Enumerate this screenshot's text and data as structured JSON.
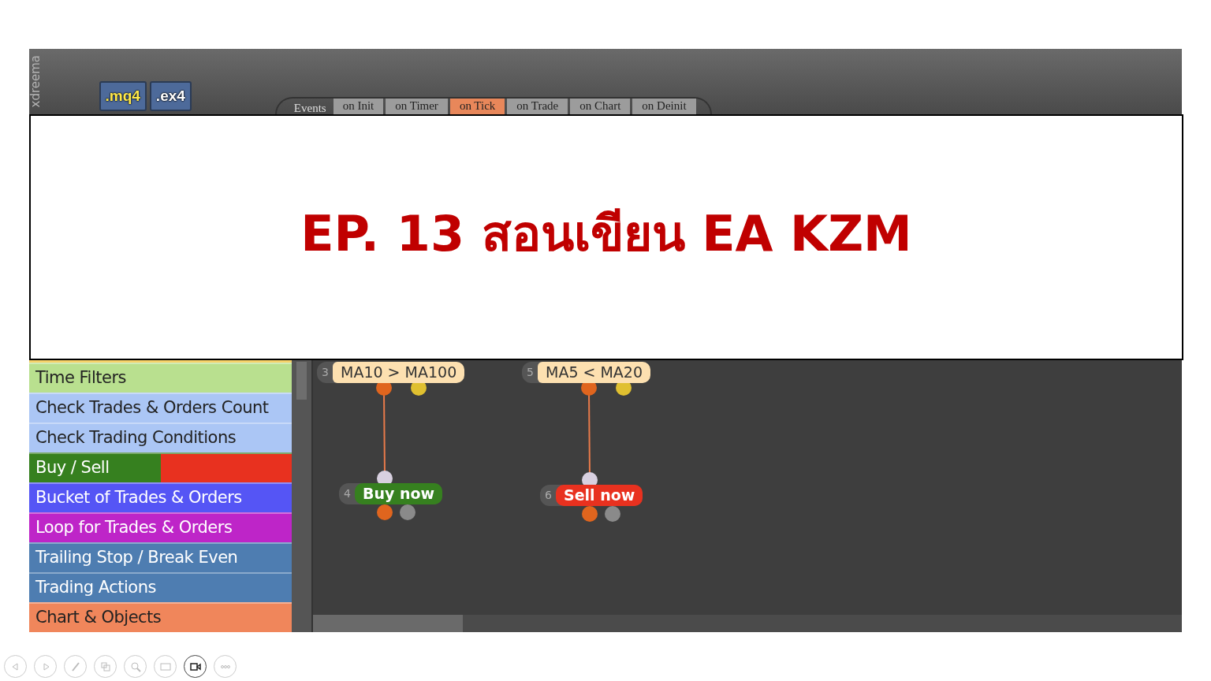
{
  "slide": {
    "title": "EP. 13 สอนเขียน EA KZM"
  },
  "app": {
    "logo_text": "xdreema",
    "file_buttons": [
      {
        "label": ".mq4",
        "kind": "mq4"
      },
      {
        "label": ".ex4",
        "kind": "ex4"
      }
    ],
    "events_label": "Events",
    "event_tabs": [
      {
        "label": "on Init",
        "selected": false
      },
      {
        "label": "on Timer",
        "selected": false
      },
      {
        "label": "on Tick",
        "selected": true
      },
      {
        "label": "on Trade",
        "selected": false
      },
      {
        "label": "on Chart",
        "selected": false
      },
      {
        "label": "on Deinit",
        "selected": false
      }
    ],
    "block_groups": [
      {
        "label": "Time Filters",
        "color": "#b9e08f"
      },
      {
        "label": "Check Trades & Orders Count",
        "color": "#abc6f5"
      },
      {
        "label": "Check Trading Conditions",
        "color": "#abc6f5"
      },
      {
        "label": "Buy / Sell",
        "color": "#36801f",
        "second_half": {
          "color": "#e8311f"
        }
      },
      {
        "label": "Bucket of Trades & Orders",
        "color": "#5555f5"
      },
      {
        "label": "Loop for Trades & Orders",
        "color": "#be25c8"
      },
      {
        "label": "Trailing Stop / Break Even",
        "color": "#4e7db1"
      },
      {
        "label": "Trading Actions",
        "color": "#4e7db1"
      },
      {
        "label": "Chart & Objects",
        "color": "#f0865b"
      }
    ],
    "nodes": [
      {
        "number": "3",
        "label": "MA10 > MA100",
        "kind": "condition"
      },
      {
        "number": "4",
        "label": "Buy now",
        "kind": "buy"
      },
      {
        "number": "5",
        "label": "MA5 < MA20",
        "kind": "condition"
      },
      {
        "number": "6",
        "label": "Sell now",
        "kind": "sell"
      }
    ]
  }
}
